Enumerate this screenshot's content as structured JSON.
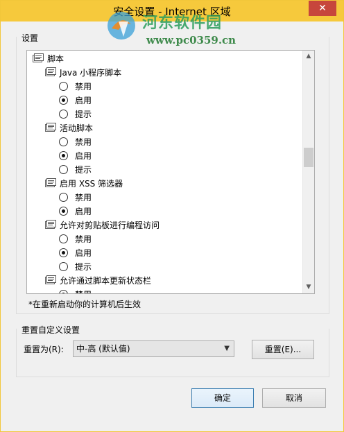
{
  "window": {
    "title": "安全设置 - Internet 区域",
    "close_label": "✕"
  },
  "watermark": {
    "name_cn": "河东软件园",
    "url": "www.pc0359.cn"
  },
  "settings": {
    "group_label": "设置",
    "tree": [
      {
        "type": "category",
        "label": "脚本",
        "indent": 0
      },
      {
        "type": "setting",
        "label": "Java 小程序脚本",
        "indent": 1
      },
      {
        "type": "option",
        "label": "禁用",
        "checked": false,
        "indent": 2
      },
      {
        "type": "option",
        "label": "启用",
        "checked": true,
        "indent": 2
      },
      {
        "type": "option",
        "label": "提示",
        "checked": false,
        "indent": 2
      },
      {
        "type": "setting",
        "label": "活动脚本",
        "indent": 1
      },
      {
        "type": "option",
        "label": "禁用",
        "checked": false,
        "indent": 2
      },
      {
        "type": "option",
        "label": "启用",
        "checked": true,
        "indent": 2
      },
      {
        "type": "option",
        "label": "提示",
        "checked": false,
        "indent": 2
      },
      {
        "type": "setting",
        "label": "启用 XSS 筛选器",
        "indent": 1
      },
      {
        "type": "option",
        "label": "禁用",
        "checked": false,
        "indent": 2
      },
      {
        "type": "option",
        "label": "启用",
        "checked": true,
        "indent": 2
      },
      {
        "type": "setting",
        "label": "允许对剪贴板进行编程访问",
        "indent": 1
      },
      {
        "type": "option",
        "label": "禁用",
        "checked": false,
        "indent": 2
      },
      {
        "type": "option",
        "label": "启用",
        "checked": true,
        "indent": 2
      },
      {
        "type": "option",
        "label": "提示",
        "checked": false,
        "indent": 2
      },
      {
        "type": "setting",
        "label": "允许通过脚本更新状态栏",
        "indent": 1
      },
      {
        "type": "option",
        "label": "禁用",
        "checked": true,
        "indent": 2
      }
    ],
    "note": "*在重新启动你的计算机后生效"
  },
  "reset": {
    "group_label": "重置自定义设置",
    "reset_to_label": "重置为(R):",
    "selected_level": "中-高 (默认值)",
    "reset_button": "重置(E)..."
  },
  "buttons": {
    "ok": "确定",
    "cancel": "取消"
  },
  "icons": {
    "folder": "settings-folder-icon",
    "scroll_up": "scroll-up-arrow-icon",
    "scroll_down": "scroll-down-arrow-icon",
    "dropdown": "chevron-down-icon",
    "close": "close-icon"
  }
}
